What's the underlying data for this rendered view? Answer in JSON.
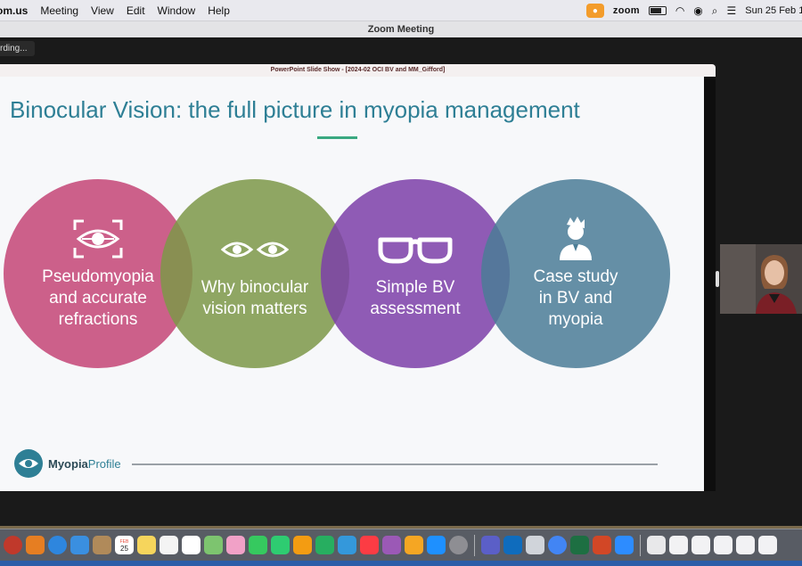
{
  "menubar": {
    "app_name": "om.us",
    "menus": [
      "Meeting",
      "View",
      "Edit",
      "Window",
      "Help"
    ],
    "zoom_label": "zoom",
    "datetime": "Sun 25 Feb  1("
  },
  "window": {
    "title": "Zoom Meeting",
    "recording_label": "rding..."
  },
  "powerpoint": {
    "window_title": "PowerPoint Slide Show  -  [2024-02 OCI BV and MM_Gifford]"
  },
  "slide": {
    "title": "Binocular Vision: the full picture in myopia management",
    "circles": [
      {
        "label_lines": [
          "Pseudomyopia",
          "and accurate",
          "refractions"
        ],
        "icon": "eye-scan-icon",
        "color": "#c44575"
      },
      {
        "label_lines": [
          "Why binocular",
          "vision matters"
        ],
        "icon": "two-eyes-icon",
        "color": "#7c9848"
      },
      {
        "label_lines": [
          "Simple BV",
          "assessment"
        ],
        "icon": "glasses-icon",
        "color": "#7d3fa8"
      },
      {
        "label_lines": [
          "Case study",
          "in BV and",
          "myopia"
        ],
        "icon": "person-icon",
        "color": "#4b7d96"
      }
    ],
    "logo": {
      "bold": "Myopia",
      "light": "Profile"
    }
  },
  "dock": {
    "calendar_day": "25",
    "calendar_month": "FEB"
  }
}
